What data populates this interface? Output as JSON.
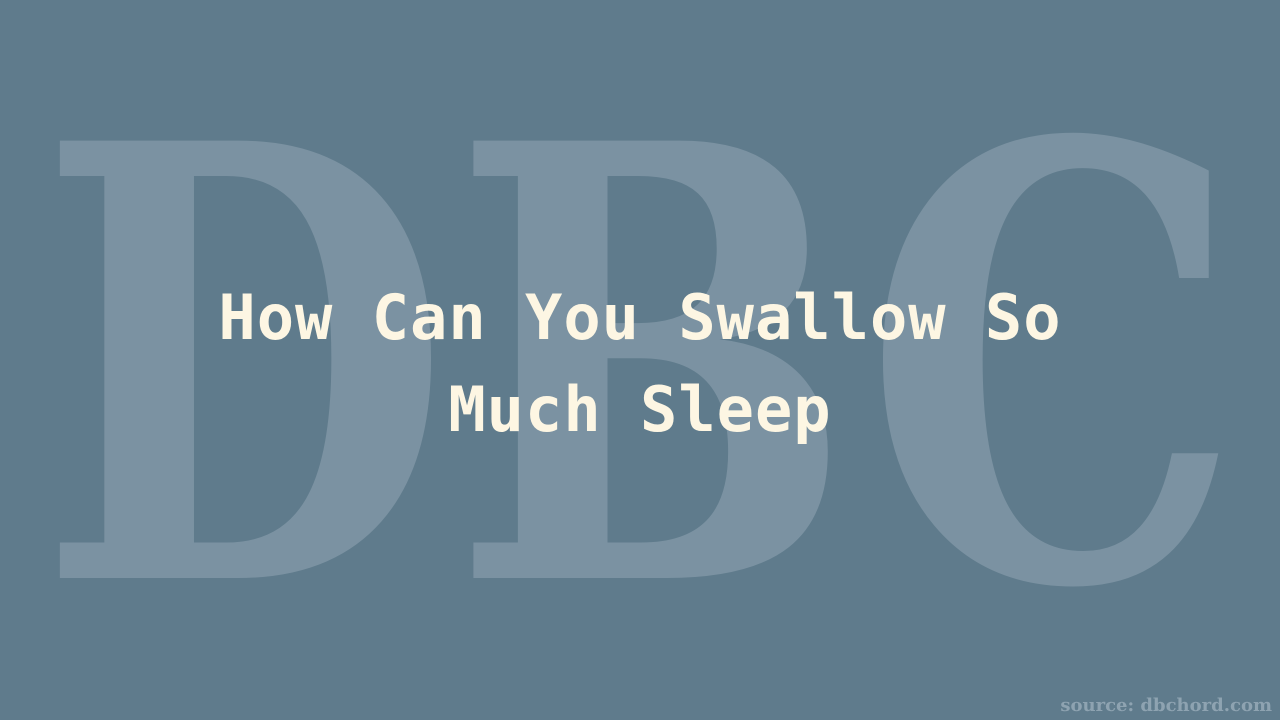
{
  "background_color": "#5f7b8c",
  "watermark": {
    "text": "DBC",
    "color": "#c7d2da"
  },
  "title": "How Can You Swallow So Much Sleep",
  "title_color": "#fdf6e3",
  "source": "source: dbchord.com"
}
